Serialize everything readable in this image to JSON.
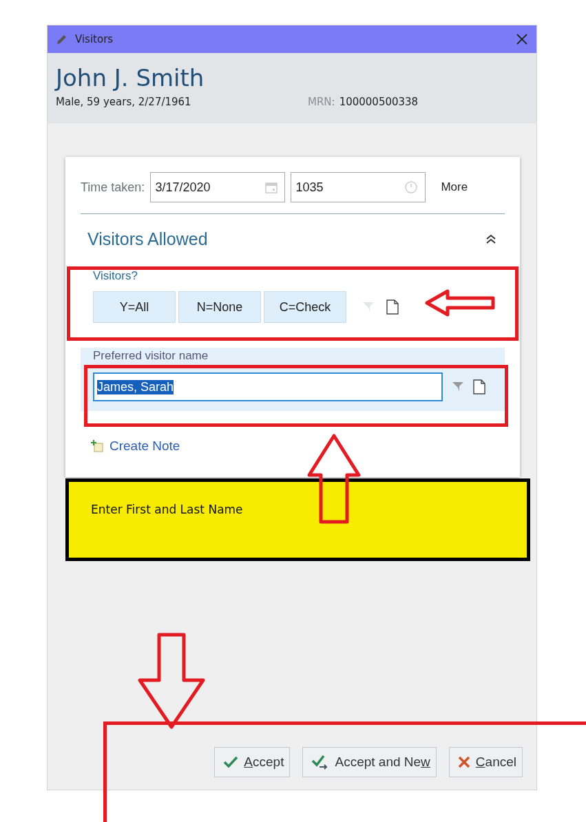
{
  "window": {
    "title": "Visitors"
  },
  "patient": {
    "name": "John J. Smith",
    "details": "Male, 59 years, 2/27/1961",
    "mrn_label": "MRN:",
    "mrn": "100000500338"
  },
  "time_taken": {
    "label": "Time taken:",
    "date": "3/17/2020",
    "time": "1035",
    "more": "More"
  },
  "section": {
    "title": "Visitors Allowed",
    "expanded": true
  },
  "visitors_question": {
    "label": "Visitors?",
    "options": [
      {
        "label": "Y=All"
      },
      {
        "label": "N=None"
      },
      {
        "label": "C=Check"
      }
    ]
  },
  "preferred_name": {
    "label": "Preferred visitor name",
    "value": "James, Sarah",
    "text_selected": true
  },
  "create_note": "Create Note",
  "annotation_note": "Enter First and Last Name",
  "buttons": [
    {
      "kind": "accept",
      "key": "A",
      "after": "ccept"
    },
    {
      "kind": "accept_new",
      "before": "Accept and Ne",
      "key": "w"
    },
    {
      "kind": "cancel",
      "key": "C",
      "after": "ancel"
    }
  ]
}
